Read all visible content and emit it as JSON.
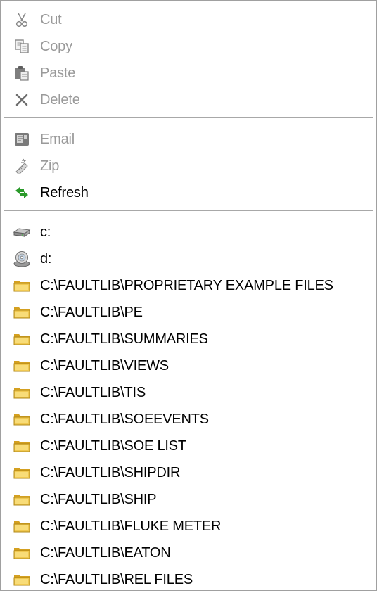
{
  "menu": {
    "edit_group": [
      {
        "label": "Cut",
        "icon": "scissors-icon",
        "enabled": false
      },
      {
        "label": "Copy",
        "icon": "copy-icon",
        "enabled": false
      },
      {
        "label": "Paste",
        "icon": "paste-icon",
        "enabled": false
      },
      {
        "label": "Delete",
        "icon": "delete-x-icon",
        "enabled": false
      }
    ],
    "action_group": [
      {
        "label": "Email",
        "icon": "email-icon",
        "enabled": false
      },
      {
        "label": "Zip",
        "icon": "zip-icon",
        "enabled": false
      },
      {
        "label": "Refresh",
        "icon": "refresh-icon",
        "enabled": true
      }
    ],
    "drives": [
      {
        "label": "c:",
        "icon": "hard-drive-icon"
      },
      {
        "label": "d:",
        "icon": "cd-drive-icon"
      }
    ],
    "folders": [
      {
        "label": "C:\\FAULTLIB\\PROPRIETARY EXAMPLE FILES",
        "icon": "folder-icon"
      },
      {
        "label": "C:\\FAULTLIB\\PE",
        "icon": "folder-icon"
      },
      {
        "label": "C:\\FAULTLIB\\SUMMARIES",
        "icon": "folder-icon"
      },
      {
        "label": "C:\\FAULTLIB\\VIEWS",
        "icon": "folder-icon"
      },
      {
        "label": "C:\\FAULTLIB\\TIS",
        "icon": "folder-icon"
      },
      {
        "label": "C:\\FAULTLIB\\SOEEVENTS",
        "icon": "folder-icon"
      },
      {
        "label": "C:\\FAULTLIB\\SOE LIST",
        "icon": "folder-icon"
      },
      {
        "label": "C:\\FAULTLIB\\SHIPDIR",
        "icon": "folder-icon"
      },
      {
        "label": "C:\\FAULTLIB\\SHIP",
        "icon": "folder-icon"
      },
      {
        "label": "C:\\FAULTLIB\\FLUKE METER",
        "icon": "folder-icon"
      },
      {
        "label": "C:\\FAULTLIB\\EATON",
        "icon": "folder-icon"
      },
      {
        "label": "C:\\FAULTLIB\\REL FILES",
        "icon": "folder-icon"
      }
    ]
  },
  "colors": {
    "disabled_text": "#9a9a9a",
    "enabled_text": "#000000",
    "folder_fill": "#f0c850",
    "refresh_green": "#2a9a2a"
  }
}
